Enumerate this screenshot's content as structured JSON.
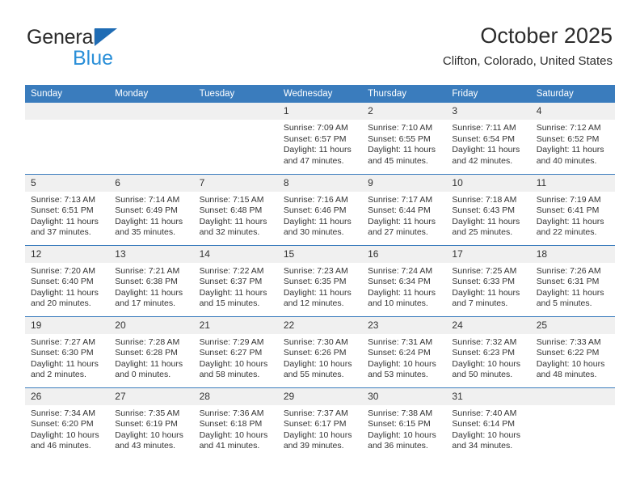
{
  "brand": {
    "name_top": "General",
    "name_bottom": "Blue",
    "accent_color": "#1f6cb4",
    "blue_text_color": "#2a8fd8"
  },
  "header": {
    "title": "October 2025",
    "subtitle": "Clifton, Colorado, United States"
  },
  "calendar": {
    "header_color": "#3a7cbd",
    "daynum_band_color": "#f0f0f0",
    "weekdays": [
      "Sunday",
      "Monday",
      "Tuesday",
      "Wednesday",
      "Thursday",
      "Friday",
      "Saturday"
    ],
    "weeks": [
      [
        {
          "day": "",
          "lines": []
        },
        {
          "day": "",
          "lines": []
        },
        {
          "day": "",
          "lines": []
        },
        {
          "day": "1",
          "lines": [
            "Sunrise: 7:09 AM",
            "Sunset: 6:57 PM",
            "Daylight: 11 hours",
            "and 47 minutes."
          ]
        },
        {
          "day": "2",
          "lines": [
            "Sunrise: 7:10 AM",
            "Sunset: 6:55 PM",
            "Daylight: 11 hours",
            "and 45 minutes."
          ]
        },
        {
          "day": "3",
          "lines": [
            "Sunrise: 7:11 AM",
            "Sunset: 6:54 PM",
            "Daylight: 11 hours",
            "and 42 minutes."
          ]
        },
        {
          "day": "4",
          "lines": [
            "Sunrise: 7:12 AM",
            "Sunset: 6:52 PM",
            "Daylight: 11 hours",
            "and 40 minutes."
          ]
        }
      ],
      [
        {
          "day": "5",
          "lines": [
            "Sunrise: 7:13 AM",
            "Sunset: 6:51 PM",
            "Daylight: 11 hours",
            "and 37 minutes."
          ]
        },
        {
          "day": "6",
          "lines": [
            "Sunrise: 7:14 AM",
            "Sunset: 6:49 PM",
            "Daylight: 11 hours",
            "and 35 minutes."
          ]
        },
        {
          "day": "7",
          "lines": [
            "Sunrise: 7:15 AM",
            "Sunset: 6:48 PM",
            "Daylight: 11 hours",
            "and 32 minutes."
          ]
        },
        {
          "day": "8",
          "lines": [
            "Sunrise: 7:16 AM",
            "Sunset: 6:46 PM",
            "Daylight: 11 hours",
            "and 30 minutes."
          ]
        },
        {
          "day": "9",
          "lines": [
            "Sunrise: 7:17 AM",
            "Sunset: 6:44 PM",
            "Daylight: 11 hours",
            "and 27 minutes."
          ]
        },
        {
          "day": "10",
          "lines": [
            "Sunrise: 7:18 AM",
            "Sunset: 6:43 PM",
            "Daylight: 11 hours",
            "and 25 minutes."
          ]
        },
        {
          "day": "11",
          "lines": [
            "Sunrise: 7:19 AM",
            "Sunset: 6:41 PM",
            "Daylight: 11 hours",
            "and 22 minutes."
          ]
        }
      ],
      [
        {
          "day": "12",
          "lines": [
            "Sunrise: 7:20 AM",
            "Sunset: 6:40 PM",
            "Daylight: 11 hours",
            "and 20 minutes."
          ]
        },
        {
          "day": "13",
          "lines": [
            "Sunrise: 7:21 AM",
            "Sunset: 6:38 PM",
            "Daylight: 11 hours",
            "and 17 minutes."
          ]
        },
        {
          "day": "14",
          "lines": [
            "Sunrise: 7:22 AM",
            "Sunset: 6:37 PM",
            "Daylight: 11 hours",
            "and 15 minutes."
          ]
        },
        {
          "day": "15",
          "lines": [
            "Sunrise: 7:23 AM",
            "Sunset: 6:35 PM",
            "Daylight: 11 hours",
            "and 12 minutes."
          ]
        },
        {
          "day": "16",
          "lines": [
            "Sunrise: 7:24 AM",
            "Sunset: 6:34 PM",
            "Daylight: 11 hours",
            "and 10 minutes."
          ]
        },
        {
          "day": "17",
          "lines": [
            "Sunrise: 7:25 AM",
            "Sunset: 6:33 PM",
            "Daylight: 11 hours",
            "and 7 minutes."
          ]
        },
        {
          "day": "18",
          "lines": [
            "Sunrise: 7:26 AM",
            "Sunset: 6:31 PM",
            "Daylight: 11 hours",
            "and 5 minutes."
          ]
        }
      ],
      [
        {
          "day": "19",
          "lines": [
            "Sunrise: 7:27 AM",
            "Sunset: 6:30 PM",
            "Daylight: 11 hours",
            "and 2 minutes."
          ]
        },
        {
          "day": "20",
          "lines": [
            "Sunrise: 7:28 AM",
            "Sunset: 6:28 PM",
            "Daylight: 11 hours",
            "and 0 minutes."
          ]
        },
        {
          "day": "21",
          "lines": [
            "Sunrise: 7:29 AM",
            "Sunset: 6:27 PM",
            "Daylight: 10 hours",
            "and 58 minutes."
          ]
        },
        {
          "day": "22",
          "lines": [
            "Sunrise: 7:30 AM",
            "Sunset: 6:26 PM",
            "Daylight: 10 hours",
            "and 55 minutes."
          ]
        },
        {
          "day": "23",
          "lines": [
            "Sunrise: 7:31 AM",
            "Sunset: 6:24 PM",
            "Daylight: 10 hours",
            "and 53 minutes."
          ]
        },
        {
          "day": "24",
          "lines": [
            "Sunrise: 7:32 AM",
            "Sunset: 6:23 PM",
            "Daylight: 10 hours",
            "and 50 minutes."
          ]
        },
        {
          "day": "25",
          "lines": [
            "Sunrise: 7:33 AM",
            "Sunset: 6:22 PM",
            "Daylight: 10 hours",
            "and 48 minutes."
          ]
        }
      ],
      [
        {
          "day": "26",
          "lines": [
            "Sunrise: 7:34 AM",
            "Sunset: 6:20 PM",
            "Daylight: 10 hours",
            "and 46 minutes."
          ]
        },
        {
          "day": "27",
          "lines": [
            "Sunrise: 7:35 AM",
            "Sunset: 6:19 PM",
            "Daylight: 10 hours",
            "and 43 minutes."
          ]
        },
        {
          "day": "28",
          "lines": [
            "Sunrise: 7:36 AM",
            "Sunset: 6:18 PM",
            "Daylight: 10 hours",
            "and 41 minutes."
          ]
        },
        {
          "day": "29",
          "lines": [
            "Sunrise: 7:37 AM",
            "Sunset: 6:17 PM",
            "Daylight: 10 hours",
            "and 39 minutes."
          ]
        },
        {
          "day": "30",
          "lines": [
            "Sunrise: 7:38 AM",
            "Sunset: 6:15 PM",
            "Daylight: 10 hours",
            "and 36 minutes."
          ]
        },
        {
          "day": "31",
          "lines": [
            "Sunrise: 7:40 AM",
            "Sunset: 6:14 PM",
            "Daylight: 10 hours",
            "and 34 minutes."
          ]
        },
        {
          "day": "",
          "lines": []
        }
      ]
    ]
  }
}
